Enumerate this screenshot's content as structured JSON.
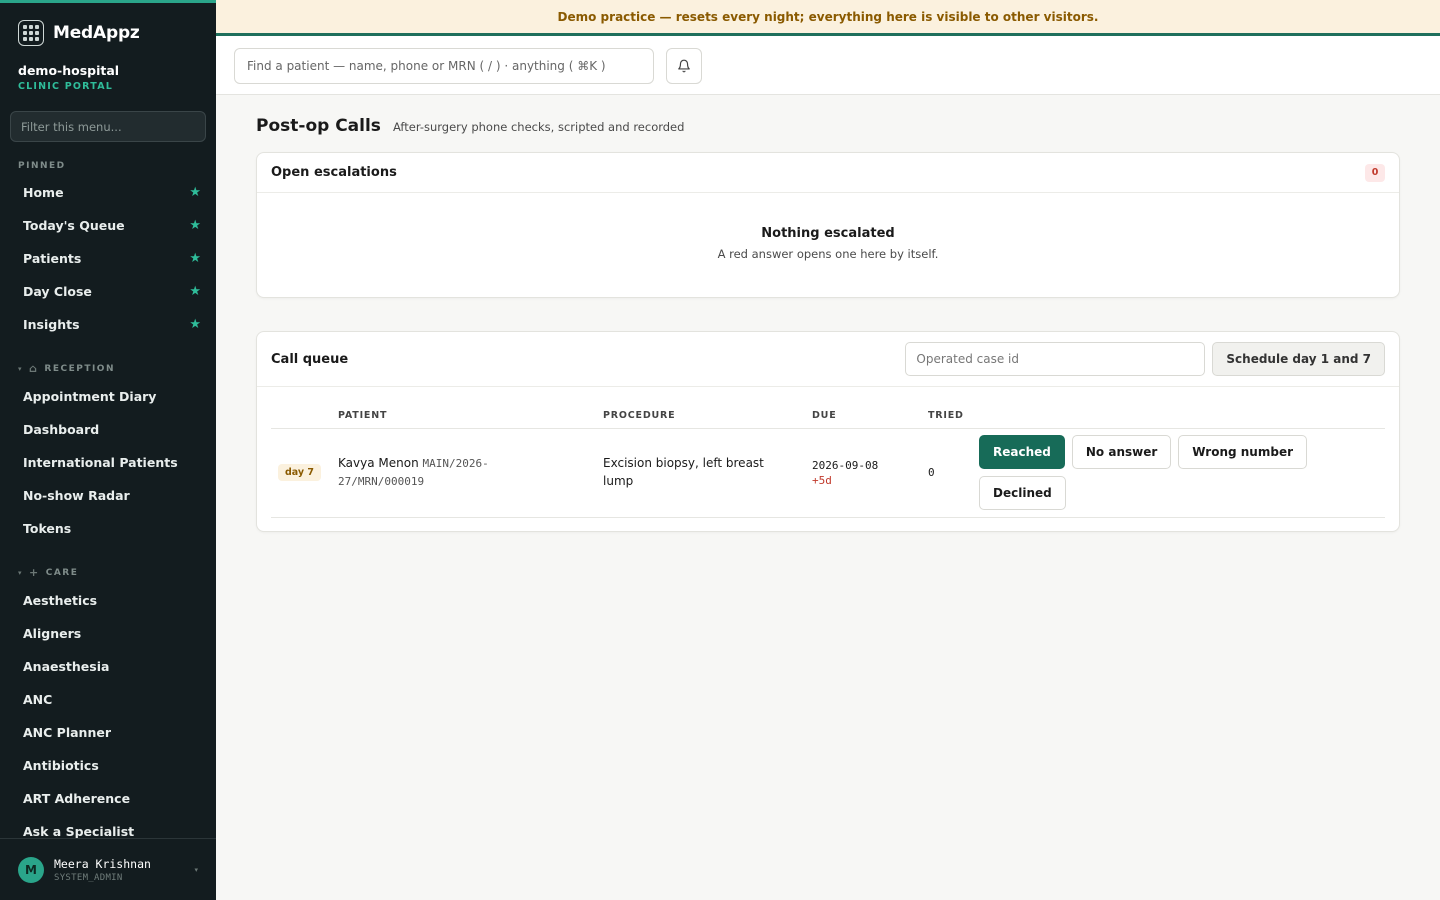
{
  "brand": {
    "name": "MedAppz"
  },
  "tenant": {
    "name": "demo-hospital",
    "subtitle": "CLINIC PORTAL"
  },
  "sidebar": {
    "filter_placeholder": "Filter this menu...",
    "pinned_label": "PINNED",
    "pinned": [
      {
        "label": "Home"
      },
      {
        "label": "Today's Queue"
      },
      {
        "label": "Patients"
      },
      {
        "label": "Day Close"
      },
      {
        "label": "Insights"
      }
    ],
    "reception": {
      "label": "RECEPTION",
      "items": [
        {
          "label": "Appointment Diary"
        },
        {
          "label": "Dashboard"
        },
        {
          "label": "International Patients"
        },
        {
          "label": "No-show Radar"
        },
        {
          "label": "Tokens"
        }
      ]
    },
    "care": {
      "label": "CARE",
      "items": [
        {
          "label": "Aesthetics"
        },
        {
          "label": "Aligners"
        },
        {
          "label": "Anaesthesia"
        },
        {
          "label": "ANC"
        },
        {
          "label": "ANC Planner"
        },
        {
          "label": "Antibiotics"
        },
        {
          "label": "ART Adherence"
        },
        {
          "label": "Ask a Specialist"
        }
      ]
    }
  },
  "user": {
    "initial": "M",
    "name": "Meera Krishnan",
    "role": "SYSTEM_ADMIN"
  },
  "banner": {
    "text": "Demo practice — resets every night; everything here is visible to other visitors."
  },
  "search": {
    "placeholder": "Find a patient — name, phone or MRN ( / ) · anything ( ⌘K )"
  },
  "page": {
    "title": "Post-op Calls",
    "subtitle": "After-surgery phone checks, scripted and recorded"
  },
  "escalations": {
    "title": "Open escalations",
    "count": "0",
    "empty_title": "Nothing escalated",
    "empty_subtitle": "A red answer opens one here by itself."
  },
  "queue": {
    "title": "Call queue",
    "case_placeholder": "Operated case id",
    "schedule_label": "Schedule day 1 and 7",
    "columns": {
      "patient": "PATIENT",
      "procedure": "PROCEDURE",
      "due": "DUE",
      "tried": "TRIED"
    },
    "rows": [
      {
        "day": "day 7",
        "patient": "Kavya Menon",
        "mrn": "MAIN/2026-27/MRN/000019",
        "procedure": "Excision biopsy, left breast lump",
        "due_date": "2026-09-08",
        "due_delta": "+5d",
        "tried": "0",
        "actions": {
          "reached": "Reached",
          "no_answer": "No answer",
          "wrong_number": "Wrong number",
          "declined": "Declined"
        }
      }
    ]
  },
  "colors": {
    "accent": "#2aa58a",
    "primary_button": "#176b58",
    "sidebar_bg": "#131c1f",
    "banner_bg": "#fbf1de",
    "danger": "#c0392b"
  }
}
